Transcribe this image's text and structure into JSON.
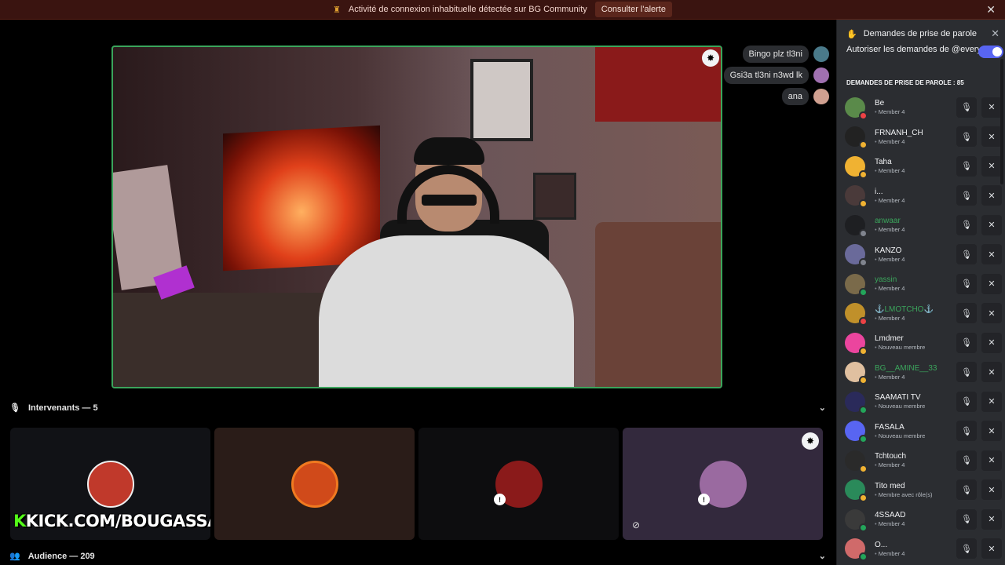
{
  "alert": {
    "icon": "warning-icon",
    "text": "Activité de connexion inhabituelle détectée sur BG Community",
    "button": "Consulter l'alerte",
    "close": "✕"
  },
  "chat": [
    {
      "text": "Bingo plz tl3ni",
      "avatar_color": "#4a7a8a"
    },
    {
      "text": "Gsi3a tl3ni n3wd lk",
      "avatar_color": "#a070b0"
    },
    {
      "text": "ana",
      "avatar_color": "#d0a090"
    }
  ],
  "speakers_section": {
    "label": "Intervenants — 5",
    "icon": "mic-icon"
  },
  "audience_section": {
    "label": "Audience — 209",
    "icon": "audience-icon"
  },
  "speaker_tiles": [
    {
      "bg": "#111216",
      "avatar": "#c0392b",
      "overlay_text": "KICK.COM/BOUGASSAA"
    },
    {
      "bg": "#2a1c18",
      "avatar": "#d04a1a"
    },
    {
      "bg": "#0d0d0f",
      "avatar": "#8a1a1a"
    },
    {
      "bg": "#33293d",
      "avatar": "#9a6aa0"
    }
  ],
  "kick": {
    "k": "K",
    "rest": "KICK.COM/BOUGASSAA"
  },
  "panel": {
    "title": "Demandes de prise de parole",
    "toggle_label": "Autoriser les demandes de @everyone",
    "toggle_on": true,
    "list_title": "DEMANDES DE PRISE DE PAROLE : 85",
    "requests": [
      {
        "name": "Be",
        "role": "Member 4",
        "avatar": "#5a8a4a",
        "status": "#ed4245",
        "green": false
      },
      {
        "name": "FRNANH_CH",
        "role": "Member 4",
        "avatar": "#222222",
        "status": "#f0b232",
        "green": false
      },
      {
        "name": "Taha",
        "role": "Member 4",
        "avatar": "#f0b232",
        "status": "#f0b232",
        "green": false
      },
      {
        "name": "i...",
        "role": "Member 4",
        "avatar": "#4a3a3a",
        "status": "#f0b232",
        "green": false
      },
      {
        "name": "anwaar",
        "role": "Member 4",
        "avatar": "#1e1f22",
        "status": "#80848e",
        "green": true
      },
      {
        "name": "KANZO",
        "role": "Member 4",
        "avatar": "#6a6a9a",
        "status": "#80848e",
        "green": false
      },
      {
        "name": "yassin",
        "role": "Member 4",
        "avatar": "#7a6a4a",
        "status": "#23a55a",
        "green": true
      },
      {
        "name": "⚓LMOTCHO⚓",
        "role": "Member 4",
        "avatar": "#c0902a",
        "status": "#ed4245",
        "green": true
      },
      {
        "name": "Lmdmer",
        "role": "Nouveau membre",
        "avatar": "#eb459e",
        "status": "#f0b232",
        "green": false
      },
      {
        "name": "BG__AMINE__33",
        "role": "Member 4",
        "avatar": "#e0c0a0",
        "status": "#f0b232",
        "green": true
      },
      {
        "name": "SAAMATI TV",
        "role": "Nouveau membre",
        "avatar": "#2a2a5a",
        "status": "#23a55a",
        "green": false
      },
      {
        "name": "FASALA",
        "role": "Nouveau membre",
        "avatar": "#5865f2",
        "status": "#23a55a",
        "green": false
      },
      {
        "name": "Tchtouch",
        "role": "Member 4",
        "avatar": "#2a2a2a",
        "status": "#f0b232",
        "green": false
      },
      {
        "name": "Tito med",
        "role": "Membre avec rôle(s)",
        "avatar": "#2a8a5a",
        "status": "#f0b232",
        "green": false
      },
      {
        "name": "4SSAAD",
        "role": "Member 4",
        "avatar": "#3a3a3a",
        "status": "#23a55a",
        "green": false
      },
      {
        "name": "O...",
        "role": "Member 4",
        "avatar": "#d06a6a",
        "status": "#23a55a",
        "green": false
      }
    ]
  }
}
